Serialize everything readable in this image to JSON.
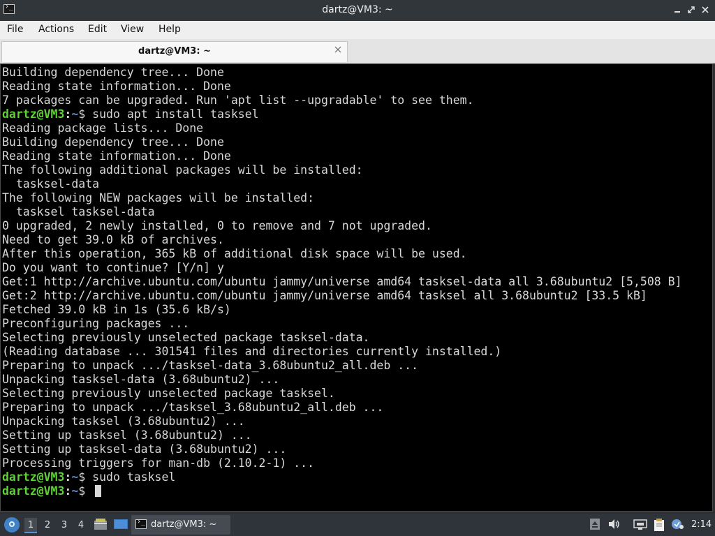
{
  "window": {
    "title": "dartz@VM3: ~"
  },
  "menu": [
    "File",
    "Actions",
    "Edit",
    "View",
    "Help"
  ],
  "tab": {
    "title": "dartz@VM3: ~"
  },
  "terminal": {
    "prompt": {
      "user_host": "dartz@VM3",
      "sep": ":",
      "path": "~",
      "symbol": "$"
    },
    "lines": [
      {
        "text": "Building dependency tree... Done"
      },
      {
        "text": "Reading state information... Done"
      },
      {
        "text": "7 packages can be upgraded. Run 'apt list --upgradable' to see them."
      },
      {
        "prompt": true,
        "text": " sudo apt install tasksel"
      },
      {
        "text": "Reading package lists... Done"
      },
      {
        "text": "Building dependency tree... Done"
      },
      {
        "text": "Reading state information... Done"
      },
      {
        "text": "The following additional packages will be installed:"
      },
      {
        "text": "  tasksel-data"
      },
      {
        "text": "The following NEW packages will be installed:"
      },
      {
        "text": "  tasksel tasksel-data"
      },
      {
        "text": "0 upgraded, 2 newly installed, 0 to remove and 7 not upgraded."
      },
      {
        "text": "Need to get 39.0 kB of archives."
      },
      {
        "text": "After this operation, 365 kB of additional disk space will be used."
      },
      {
        "text": "Do you want to continue? [Y/n] y"
      },
      {
        "text": "Get:1 http://archive.ubuntu.com/ubuntu jammy/universe amd64 tasksel-data all 3.68ubuntu2 [5,508 B]"
      },
      {
        "text": "Get:2 http://archive.ubuntu.com/ubuntu jammy/universe amd64 tasksel all 3.68ubuntu2 [33.5 kB]"
      },
      {
        "text": "Fetched 39.0 kB in 1s (35.6 kB/s)"
      },
      {
        "text": "Preconfiguring packages ..."
      },
      {
        "text": "Selecting previously unselected package tasksel-data."
      },
      {
        "text": "(Reading database ... 301541 files and directories currently installed.)"
      },
      {
        "text": "Preparing to unpack .../tasksel-data_3.68ubuntu2_all.deb ..."
      },
      {
        "text": "Unpacking tasksel-data (3.68ubuntu2) ..."
      },
      {
        "text": "Selecting previously unselected package tasksel."
      },
      {
        "text": "Preparing to unpack .../tasksel_3.68ubuntu2_all.deb ..."
      },
      {
        "text": "Unpacking tasksel (3.68ubuntu2) ..."
      },
      {
        "text": "Setting up tasksel (3.68ubuntu2) ..."
      },
      {
        "text": "Setting up tasksel-data (3.68ubuntu2) ..."
      },
      {
        "text": "Processing triggers for man-db (2.10.2-1) ..."
      },
      {
        "prompt": true,
        "text": " sudo tasksel"
      },
      {
        "prompt": true,
        "text": " ",
        "cursor": true
      }
    ]
  },
  "taskbar": {
    "workspaces": [
      "1",
      "2",
      "3",
      "4"
    ],
    "active_workspace": "1",
    "task_label": "dartz@VM3: ~",
    "clock": "2:14"
  },
  "icons": {
    "app": "terminal-icon",
    "start": "lxqt-menu-icon",
    "file_manager": "file-manager-icon",
    "desktop": "show-desktop-icon",
    "tray": [
      "eject-icon",
      "volume-icon",
      "network-icon",
      "clipboard-icon",
      "update-notifier-icon"
    ]
  }
}
